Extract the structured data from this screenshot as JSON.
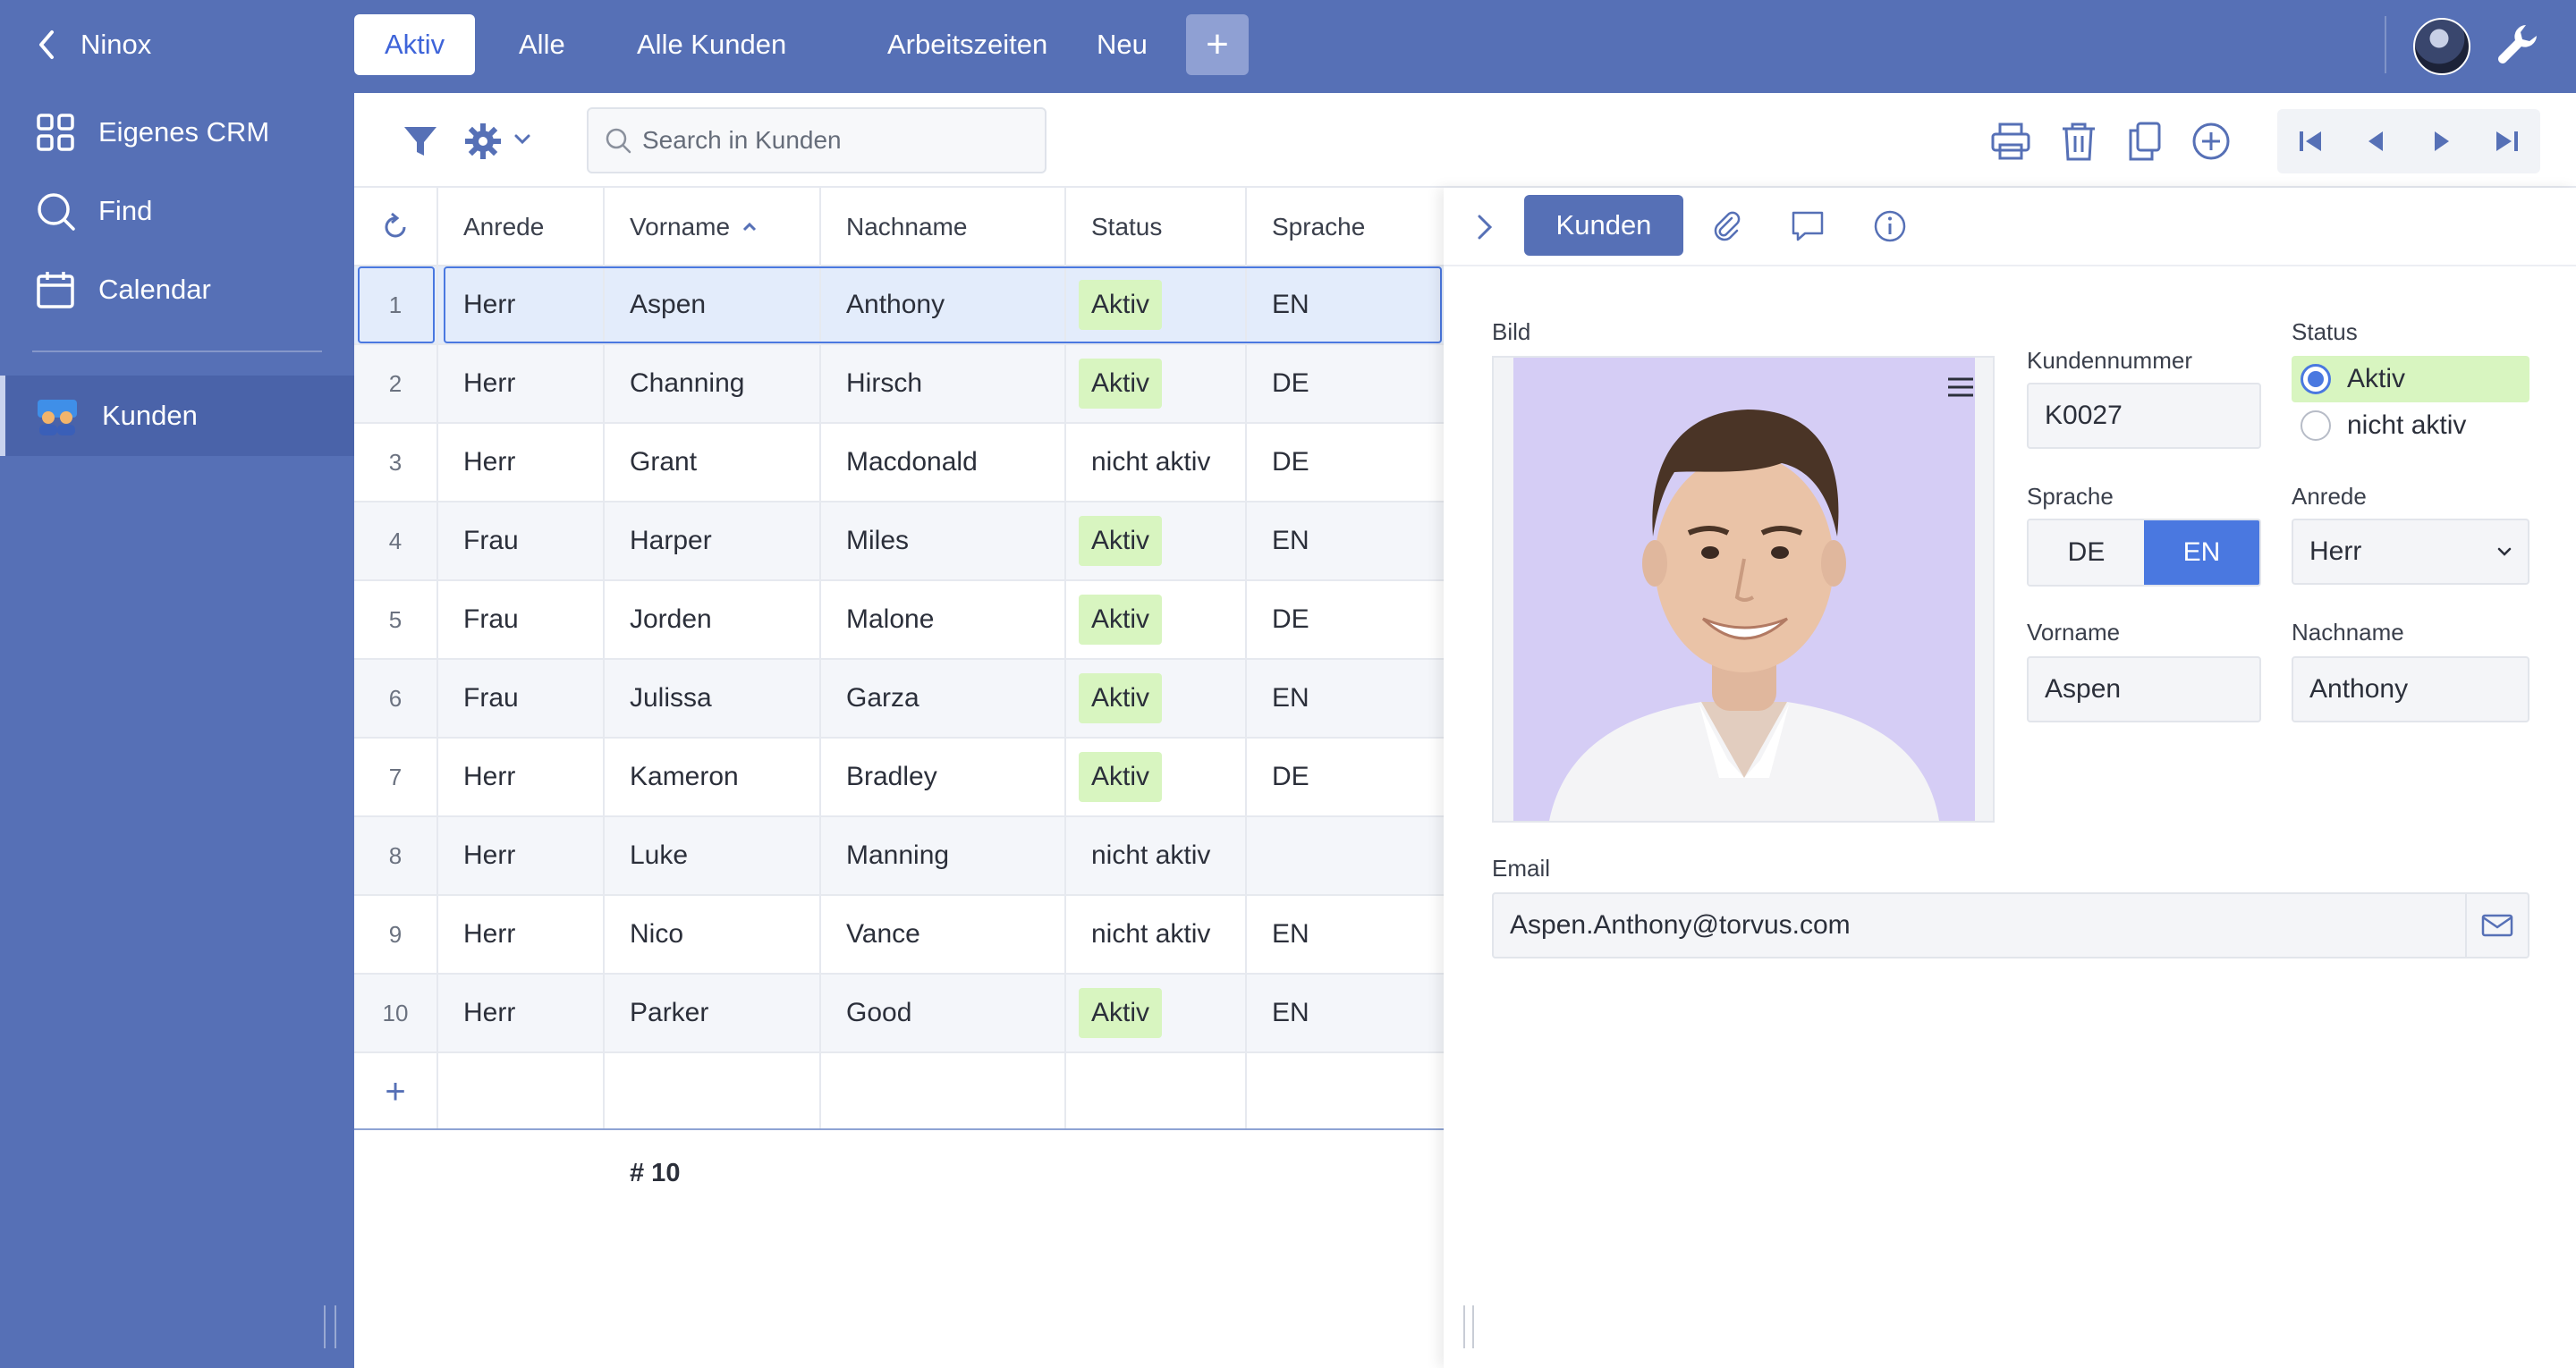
{
  "sidebar": {
    "back_label": "Ninox",
    "items": [
      {
        "label": "Eigenes CRM",
        "icon": "grid-icon"
      },
      {
        "label": "Find",
        "icon": "search-icon"
      },
      {
        "label": "Calendar",
        "icon": "calendar-icon"
      }
    ],
    "active": {
      "label": "Kunden",
      "icon": "people-icon"
    }
  },
  "tabs": [
    {
      "label": "Aktiv",
      "active": true
    },
    {
      "label": "Alle"
    },
    {
      "label": "Alle Kunden"
    },
    {
      "label": "Arbeitszeiten"
    },
    {
      "label": "Neu"
    }
  ],
  "toolbar": {
    "search_placeholder": "Search in Kunden"
  },
  "table": {
    "columns": [
      "Anrede",
      "Vorname",
      "Nachname",
      "Status",
      "Sprache"
    ],
    "sort_column": "Vorname",
    "rows": [
      {
        "num": "1",
        "anrede": "Herr",
        "vorname": "Aspen",
        "nachname": "Anthony",
        "status": "Aktiv",
        "sprache": "EN"
      },
      {
        "num": "2",
        "anrede": "Herr",
        "vorname": "Channing",
        "nachname": "Hirsch",
        "status": "Aktiv",
        "sprache": "DE"
      },
      {
        "num": "3",
        "anrede": "Herr",
        "vorname": "Grant",
        "nachname": "Macdonald",
        "status": "nicht aktiv",
        "sprache": "DE"
      },
      {
        "num": "4",
        "anrede": "Frau",
        "vorname": "Harper",
        "nachname": "Miles",
        "status": "Aktiv",
        "sprache": "EN"
      },
      {
        "num": "5",
        "anrede": "Frau",
        "vorname": "Jorden",
        "nachname": "Malone",
        "status": "Aktiv",
        "sprache": "DE"
      },
      {
        "num": "6",
        "anrede": "Frau",
        "vorname": "Julissa",
        "nachname": "Garza",
        "status": "Aktiv",
        "sprache": "EN"
      },
      {
        "num": "7",
        "anrede": "Herr",
        "vorname": "Kameron",
        "nachname": "Bradley",
        "status": "Aktiv",
        "sprache": "DE"
      },
      {
        "num": "8",
        "anrede": "Herr",
        "vorname": "Luke",
        "nachname": "Manning",
        "status": "nicht aktiv",
        "sprache": ""
      },
      {
        "num": "9",
        "anrede": "Herr",
        "vorname": "Nico",
        "nachname": "Vance",
        "status": "nicht aktiv",
        "sprache": "EN"
      },
      {
        "num": "10",
        "anrede": "Herr",
        "vorname": "Parker",
        "nachname": "Good",
        "status": "Aktiv",
        "sprache": "EN"
      }
    ],
    "count_label": "# 10"
  },
  "detail": {
    "tab_label": "Kunden",
    "bild_label": "Bild",
    "kundennummer_label": "Kundennummer",
    "kundennummer": "K0027",
    "status_label": "Status",
    "status_options": [
      "Aktiv",
      "nicht aktiv"
    ],
    "status_selected": "Aktiv",
    "sprache_label": "Sprache",
    "sprache_options": [
      "DE",
      "EN"
    ],
    "sprache_selected": "EN",
    "anrede_label": "Anrede",
    "anrede": "Herr",
    "vorname_label": "Vorname",
    "vorname": "Aspen",
    "nachname_label": "Nachname",
    "nachname": "Anthony",
    "email_label": "Email",
    "email": "Aspen.Anthony@torvus.com"
  },
  "colors": {
    "sidebar": "#5670b6",
    "accent": "#4a78e0",
    "active_badge": "#d8f5c0",
    "photo_bg": "#d5cdf5"
  }
}
